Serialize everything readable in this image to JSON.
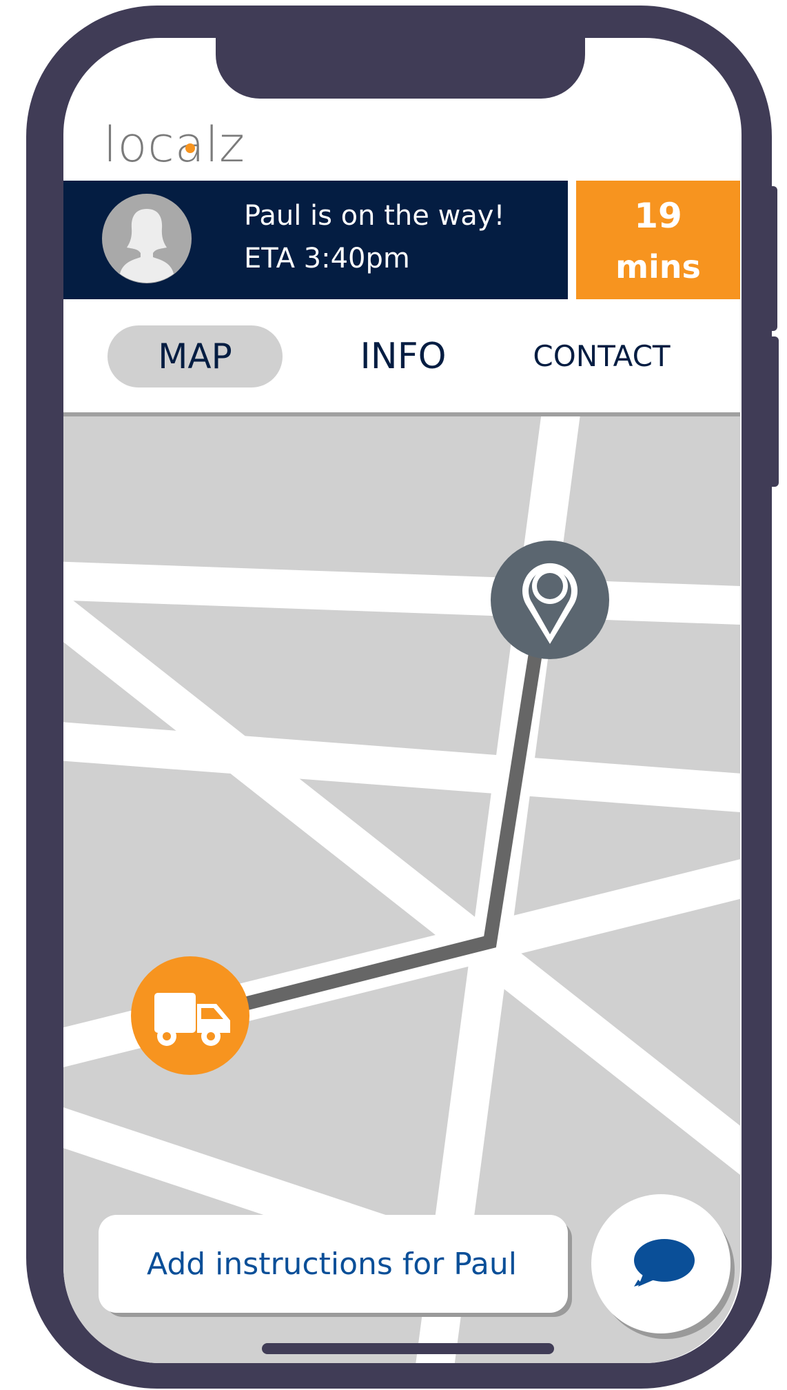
{
  "app": {
    "logo_text": "localz"
  },
  "eta_banner": {
    "line1": "Paul is on the way!",
    "line2": "ETA 3:40pm",
    "minutes_value": "19",
    "minutes_unit": "mins"
  },
  "tabs": [
    {
      "label": "MAP",
      "active": true
    },
    {
      "label": "INFO",
      "active": false
    },
    {
      "label": "CONTACT",
      "active": false
    }
  ],
  "map": {
    "destination_marker_icon": "location-pin-icon",
    "driver_marker_icon": "delivery-truck-icon"
  },
  "instructions": {
    "label": "Add instructions for Paul"
  },
  "chat": {
    "icon": "chat-bubble-icon"
  },
  "colors": {
    "frame": "#403c56",
    "banner": "#041d42",
    "accent_orange": "#f7941f",
    "map_background": "#d0d0d0",
    "road": "#ffffff",
    "route": "#666666",
    "pin_marker": "#5b6670",
    "link_blue": "#0a4f98"
  }
}
